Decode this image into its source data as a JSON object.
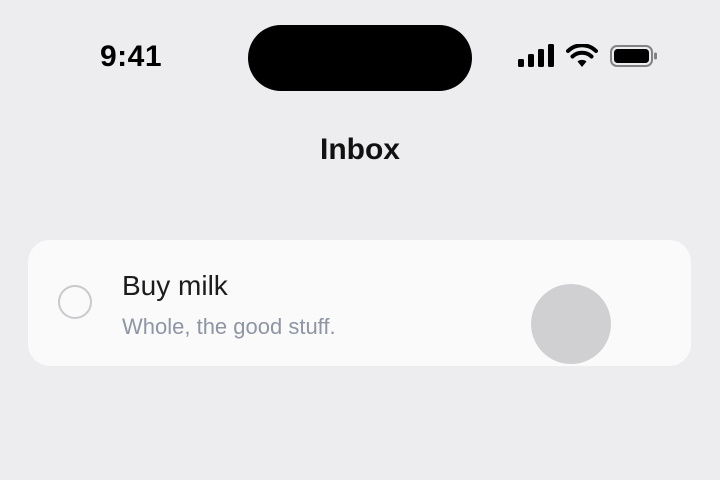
{
  "status_bar": {
    "time": "9:41",
    "icons": [
      "cellular-signal-icon",
      "wifi-icon",
      "battery-icon"
    ]
  },
  "nav": {
    "title": "Inbox"
  },
  "tasks": [
    {
      "title": "Buy milk",
      "note": "Whole, the good stuff.",
      "completed": false
    }
  ],
  "colors": {
    "background": "#EDEDF0",
    "card": "#FAFAFA",
    "note_text": "#8E95A3",
    "checkbox_border": "#C9C9CE",
    "touch_indicator": "#D0D0D3"
  }
}
